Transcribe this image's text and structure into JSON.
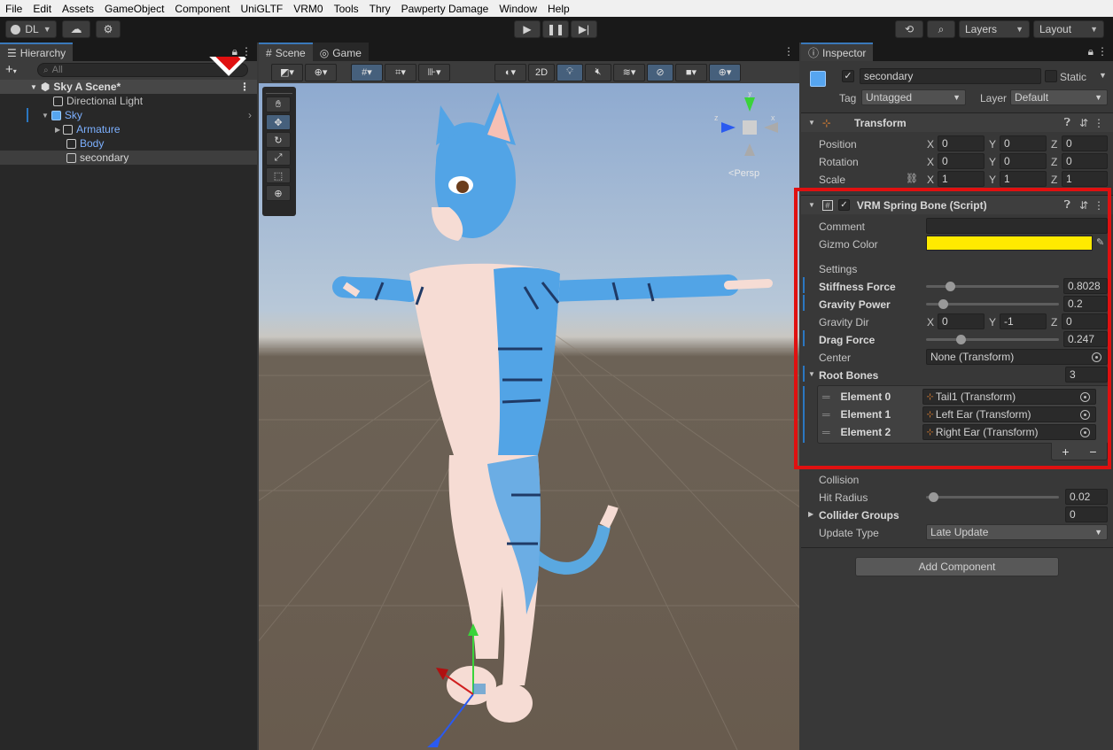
{
  "menu": [
    "File",
    "Edit",
    "Assets",
    "GameObject",
    "Component",
    "UniGLTF",
    "VRM0",
    "Tools",
    "Thry",
    "Pawperty Damage",
    "Window",
    "Help"
  ],
  "toolbar": {
    "account": "DL",
    "layers": "Layers",
    "layout": "Layout"
  },
  "hierarchy": {
    "tab": "Hierarchy",
    "search_placeholder": "All",
    "scene": "Sky A Scene*",
    "items": [
      {
        "label": "Directional Light",
        "depth": 1
      },
      {
        "label": "Sky",
        "depth": 1
      },
      {
        "label": "Armature",
        "depth": 2
      },
      {
        "label": "Body",
        "depth": 2
      },
      {
        "label": "secondary",
        "depth": 2
      }
    ]
  },
  "scene": {
    "tabs": [
      "Scene",
      "Game"
    ],
    "mode_2d": "2D",
    "persp": "Persp"
  },
  "inspector": {
    "tab": "Inspector",
    "object_name": "secondary",
    "static_label": "Static",
    "tag_label": "Tag",
    "tag_value": "Untagged",
    "layer_label": "Layer",
    "layer_value": "Default",
    "transform": {
      "title": "Transform",
      "rows": [
        {
          "label": "Position",
          "x": "0",
          "y": "0",
          "z": "0"
        },
        {
          "label": "Rotation",
          "x": "0",
          "y": "0",
          "z": "0"
        },
        {
          "label": "Scale",
          "x": "1",
          "y": "1",
          "z": "1"
        }
      ]
    },
    "spring": {
      "title": "VRM Spring Bone (Script)",
      "comment_label": "Comment",
      "comment_value": "",
      "gizmo_label": "Gizmo Color",
      "gizmo_color": "#ffea00",
      "settings_label": "Settings",
      "stiffness_label": "Stiffness Force",
      "stiffness_value": "0.8028",
      "stiffness_level": 0.16,
      "gravity_power_label": "Gravity Power",
      "gravity_power_value": "0.2",
      "gravity_power_level": 0.1,
      "gravity_dir_label": "Gravity Dir",
      "gravity_dir": {
        "x": "0",
        "y": "-1",
        "z": "0"
      },
      "drag_label": "Drag Force",
      "drag_value": "0.247",
      "drag_level": 0.247,
      "center_label": "Center",
      "center_value": "None (Transform)",
      "root_bones_label": "Root Bones",
      "root_bones_count": "3",
      "elements": [
        {
          "label": "Element 0",
          "value": "Tail1 (Transform)"
        },
        {
          "label": "Element 1",
          "value": "Left Ear (Transform)"
        },
        {
          "label": "Element 2",
          "value": "Right Ear (Transform)"
        }
      ],
      "plus": "+",
      "minus": "−",
      "collision_label": "Collision",
      "hit_radius_label": "Hit Radius",
      "hit_radius_value": "0.02",
      "hit_radius_level": 0.02,
      "collider_groups_label": "Collider Groups",
      "collider_groups_value": "0",
      "update_type_label": "Update Type",
      "update_type_value": "Late Update"
    },
    "add_component": "Add Component"
  },
  "colors": {
    "highlight_red": "#e01010",
    "accent_blue": "#3a79bb"
  }
}
